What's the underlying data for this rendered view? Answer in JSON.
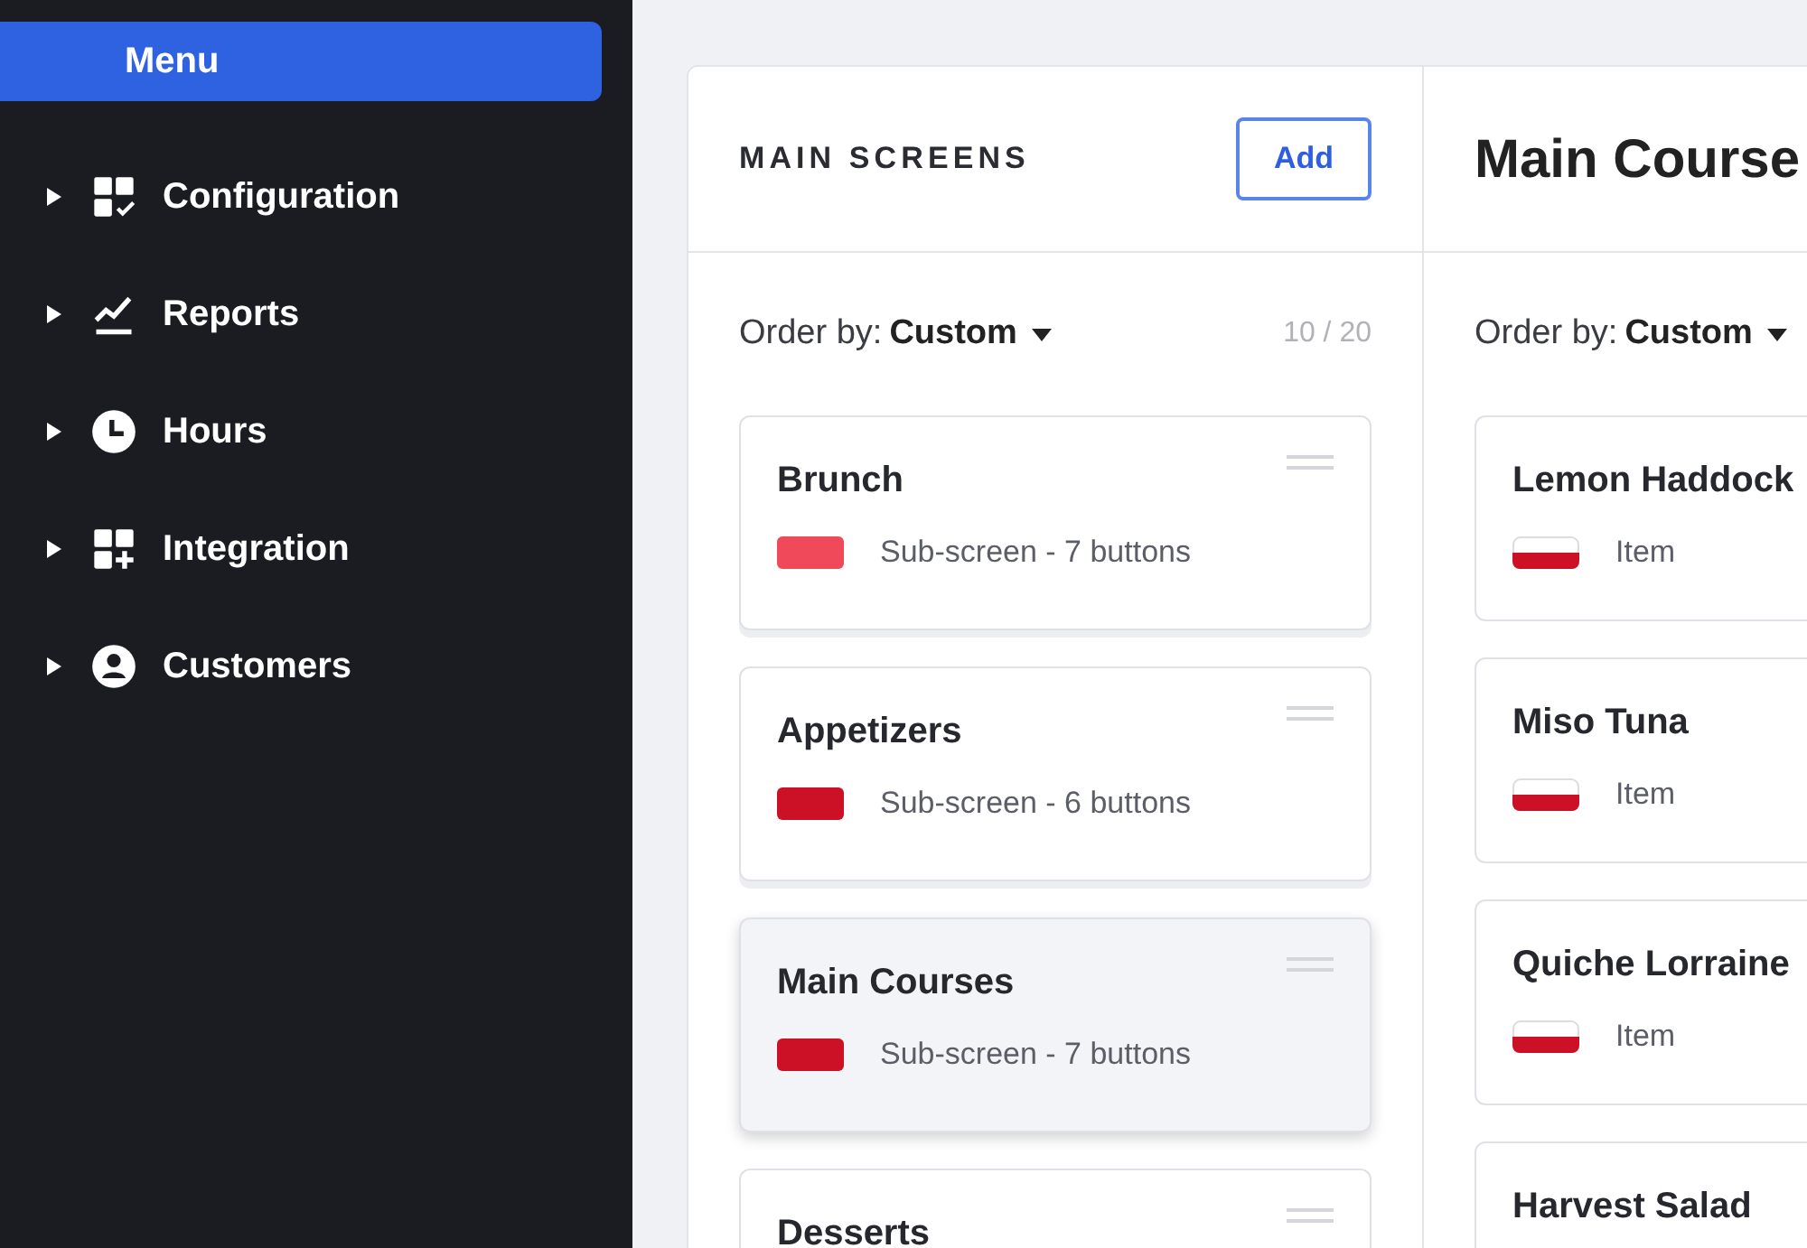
{
  "sidebar": {
    "menu_button": "Menu",
    "items": [
      {
        "label": "Configuration",
        "expanded": false
      },
      {
        "label": "Reports",
        "expanded": false
      },
      {
        "label": "Hours",
        "expanded": false
      },
      {
        "label": "Integration",
        "expanded": false
      },
      {
        "label": "Customers",
        "expanded": false
      }
    ]
  },
  "main_screens": {
    "title": "MAIN SCREENS",
    "add_button": "Add",
    "order_label": "Order by:",
    "order_value": "Custom",
    "count": "10 / 20",
    "screens": [
      {
        "name": "Brunch",
        "detail": "Sub-screen - 7 buttons",
        "color": "#f0495a",
        "selected": false
      },
      {
        "name": "Appetizers",
        "detail": "Sub-screen - 6 buttons",
        "color": "#cc1025",
        "selected": false
      },
      {
        "name": "Main Courses",
        "detail": "Sub-screen - 7 buttons",
        "color": "#cc1025",
        "selected": true
      },
      {
        "name": "Desserts",
        "selected": false
      }
    ]
  },
  "detail_panel": {
    "title": "Main Course",
    "order_label": "Order by:",
    "order_value": "Custom",
    "items": [
      {
        "name": "Lemon Haddock",
        "kind": "Item"
      },
      {
        "name": "Miso Tuna",
        "kind": "Item"
      },
      {
        "name": "Quiche Lorraine",
        "kind": "Item"
      },
      {
        "name": "Harvest Salad"
      }
    ]
  }
}
